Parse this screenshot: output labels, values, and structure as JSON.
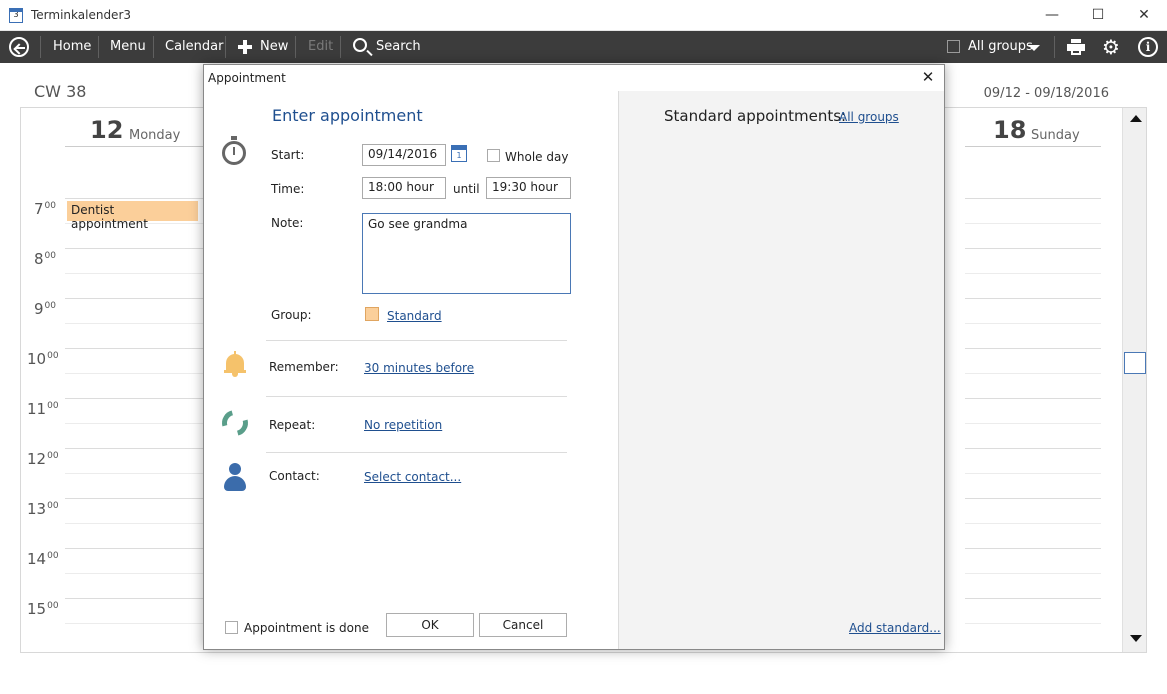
{
  "window": {
    "title": "Terminkalender3",
    "app_icon_text": "3",
    "minimize": "—",
    "maximize": "☐",
    "close": "✕"
  },
  "toolbar": {
    "home": "Home",
    "menu": "Menu",
    "calendar": "Calendar",
    "new": "New",
    "edit": "Edit",
    "search": "Search",
    "groups": "All groups"
  },
  "calendar": {
    "week_label": "CW 38",
    "date_range": "09/12 - 09/18/2016",
    "days": [
      {
        "number": "12",
        "name": "Monday"
      },
      {
        "number": "18",
        "name": "Sunday"
      }
    ],
    "hours": [
      {
        "h": "7",
        "m": "00"
      },
      {
        "h": "8",
        "m": "00"
      },
      {
        "h": "9",
        "m": "00"
      },
      {
        "h": "10",
        "m": "00"
      },
      {
        "h": "11",
        "m": "00"
      },
      {
        "h": "12",
        "m": "00"
      },
      {
        "h": "13",
        "m": "00"
      },
      {
        "h": "14",
        "m": "00"
      },
      {
        "h": "15",
        "m": "00"
      }
    ],
    "event": "Dentist appointment",
    "event_color": "#fbcf9a"
  },
  "dialog": {
    "title": "Appointment",
    "close": "✕",
    "heading": "Enter appointment",
    "start_label": "Start:",
    "start_value": "09/14/2016",
    "whole_day": "Whole day",
    "time_label": "Time:",
    "time_from": "18:00 hour",
    "until": "until",
    "time_to": "19:30 hour",
    "note_label": "Note:",
    "note_value": "Go see grandma",
    "group_label": "Group:",
    "group_value": "Standard",
    "remember_label": "Remember:",
    "remember_value": "30 minutes before",
    "repeat_label": "Repeat:",
    "repeat_value": "No repetition",
    "contact_label": "Contact:",
    "contact_value": "Select contact...",
    "done_label": "Appointment is done",
    "ok": "OK",
    "cancel": "Cancel",
    "standard_label": "Standard appointments:",
    "standard_groups": "All groups",
    "add_standard": "Add standard..."
  },
  "colors": {
    "toolbar_bg": "#3c3c3c",
    "accent_blue": "#1f4f8f",
    "bell": "#f5c26b",
    "repeat": "#5a9e8a",
    "contact": "#3b6cab"
  }
}
